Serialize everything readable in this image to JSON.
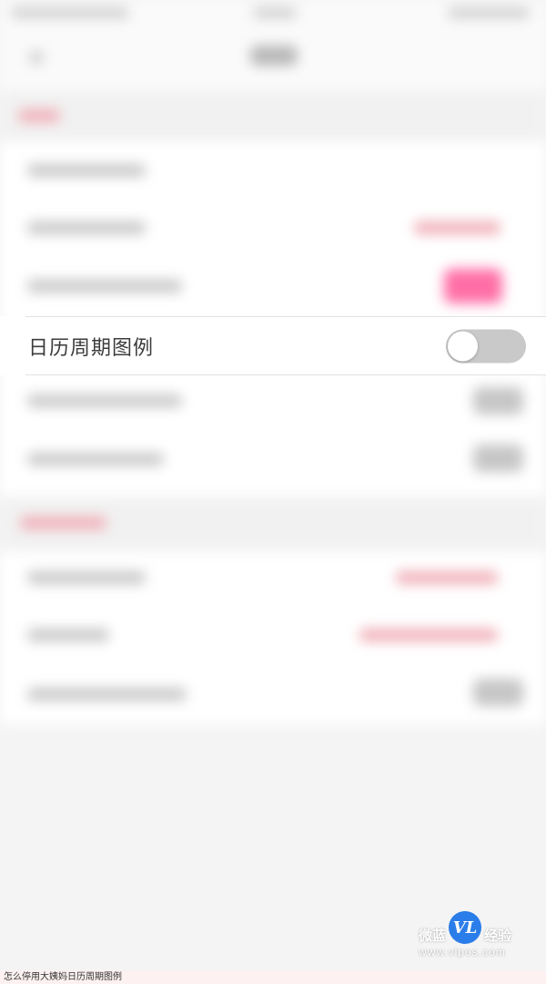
{
  "setting_row": {
    "label": "日历周期图例",
    "toggle_on": false
  },
  "watermark": {
    "left_text": "微蓝",
    "logo_text": "VL",
    "right_text": "经验",
    "url": "www.vlpos.com"
  },
  "caption": "怎么停用大姨妈日历周期图例",
  "colors": {
    "toggle_off": "#c9c9c9",
    "accent_pink": "#ff6fa6",
    "logo_blue": "#2b7de9"
  }
}
